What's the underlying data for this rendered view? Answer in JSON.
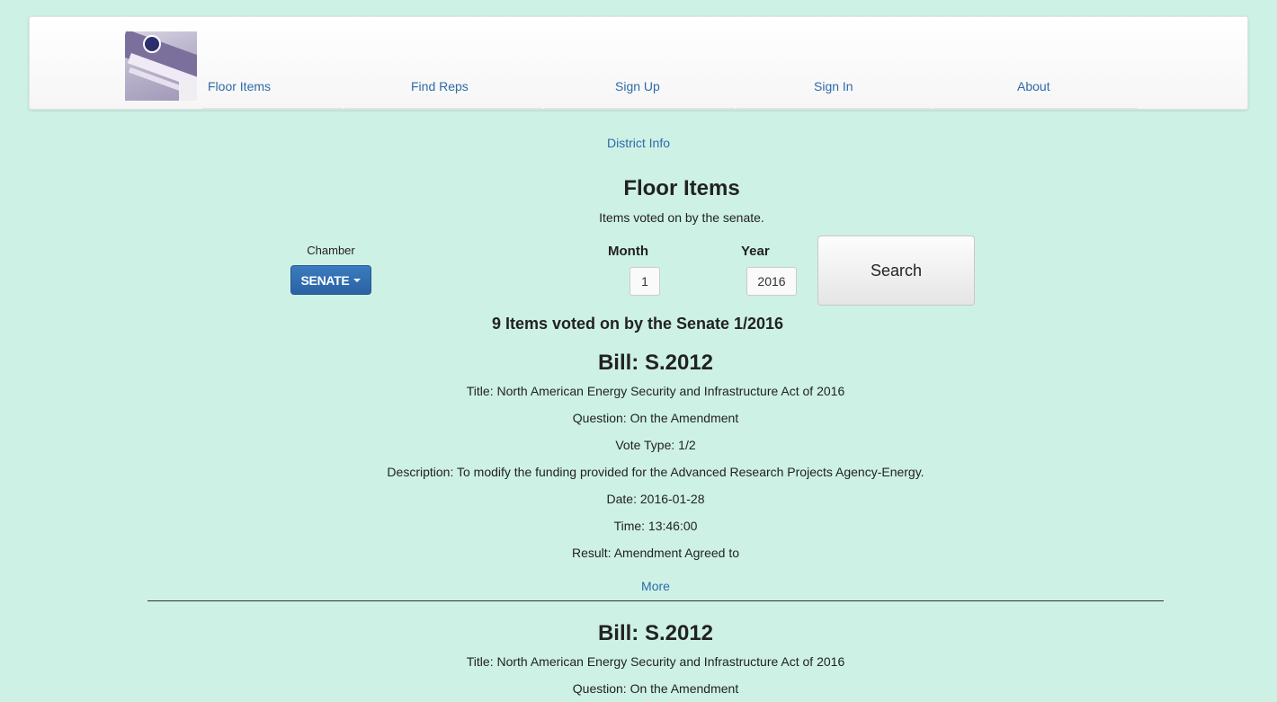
{
  "nav": {
    "links": [
      "Floor Items",
      "Find Reps",
      "Sign Up",
      "Sign In",
      "About"
    ],
    "logo_icon": "ballot-drop-box-logo"
  },
  "district_link": "District Info",
  "page": {
    "title": "Floor Items",
    "subtitle": "Items voted on by the senate."
  },
  "filters": {
    "chamber_label": "Chamber",
    "chamber_value": "SENATE",
    "month_label": "Month",
    "month_value": "1",
    "year_label": "Year",
    "year_value": "2016",
    "search_label": "Search"
  },
  "results_summary": "9 Items voted on by the Senate 1/2016",
  "items": [
    {
      "bill": "Bill: S.2012",
      "title": "Title: North American Energy Security and Infrastructure Act of 2016",
      "question": "Question: On the Amendment",
      "vote_type": "Vote Type: 1/2",
      "description": "Description: To modify the funding provided for the Advanced Research Projects Agency-Energy.",
      "date": "Date: 2016-01-28",
      "time": "Time: 13:46:00",
      "result": "Result: Amendment Agreed to",
      "more": "More"
    },
    {
      "bill": "Bill: S.2012",
      "title": "Title: North American Energy Security and Infrastructure Act of 2016",
      "question": "Question: On the Amendment"
    }
  ],
  "colors": {
    "background": "#cdf1e5",
    "link": "#2f6aa8",
    "primary_button": "#2a62a4"
  }
}
